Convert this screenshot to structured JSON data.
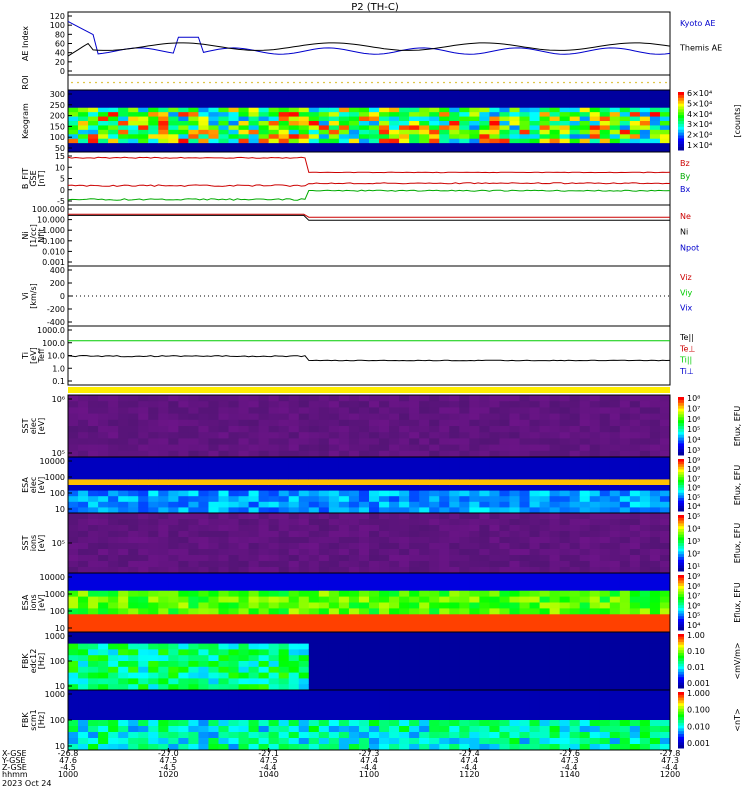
{
  "title": "P2 (TH-C)",
  "colors": {
    "frame": "#000000",
    "kyoto": "#0000cc",
    "themis": "#000000",
    "bz": "#cc0000",
    "by": "#00aa00",
    "bx": "#0000cc",
    "green": "#00cc00",
    "red": "#cc0000",
    "blue": "#0000cc",
    "flag": "#ffee00"
  },
  "panels": [
    {
      "id": "ae",
      "ylabel": [
        "AE Index"
      ],
      "ticks": [
        "120",
        "100",
        "80",
        "60",
        "40",
        "20",
        "0"
      ],
      "legend": [
        {
          "t": "Kyoto AE",
          "c": "#0000cc"
        },
        {
          "t": "Themis AE",
          "c": "#000000"
        }
      ]
    },
    {
      "id": "roi",
      "ylabel": [
        "ROI"
      ],
      "ticks": [],
      "legend": []
    },
    {
      "id": "keo",
      "ylabel": [
        "Keogram"
      ],
      "ticks": [
        "300",
        "250",
        "200",
        "150",
        "100",
        "50"
      ],
      "legend": [],
      "colorbar": {
        "labels": [
          "6×10⁴",
          "5×10⁴",
          "4×10⁴",
          "3×10⁴",
          "2×10⁴",
          "1×10⁴"
        ],
        "unit": "[counts]"
      }
    },
    {
      "id": "bfit",
      "ylabel": [
        "B_FIT",
        "GSE",
        "[nT]"
      ],
      "ticks": [
        "15",
        "10",
        "5",
        "0",
        "-5"
      ],
      "legend": [
        {
          "t": "Bz",
          "c": "#cc0000"
        },
        {
          "t": "By",
          "c": "#00aa00"
        },
        {
          "t": "Bx",
          "c": "#0000cc"
        }
      ]
    },
    {
      "id": "ni",
      "ylabel": [
        "Ni",
        "[1/cc]",
        "Nfit"
      ],
      "ticks": [
        "100.000",
        "10.000",
        "1.000",
        "0.100",
        "0.010",
        "0.001"
      ],
      "legend": [
        {
          "t": "Ne",
          "c": "#cc0000"
        },
        {
          "t": "Ni",
          "c": "#000000"
        },
        {
          "t": "Npot",
          "c": "#0000cc"
        }
      ]
    },
    {
      "id": "vi",
      "ylabel": [
        "Vi",
        "[km/s]"
      ],
      "ticks": [
        "400",
        "200",
        "0",
        "-200",
        "-400"
      ],
      "legend": [
        {
          "t": "Viz",
          "c": "#cc0000"
        },
        {
          "t": "Viy",
          "c": "#00cc00"
        },
        {
          "t": "Vix",
          "c": "#0000cc"
        }
      ]
    },
    {
      "id": "ti",
      "ylabel": [
        "Ti",
        "[eV]",
        "Teff"
      ],
      "ticks": [
        "1000.0",
        "100.0",
        "10.0",
        "1.0",
        "0.1"
      ],
      "legend": [
        {
          "t": "Te||",
          "c": "#000000"
        },
        {
          "t": "Te⊥",
          "c": "#cc0000"
        },
        {
          "t": "Ti||",
          "c": "#00cc00"
        },
        {
          "t": "Ti⊥",
          "c": "#0000cc"
        }
      ]
    },
    {
      "id": "sste",
      "ylabel": [
        "SST",
        "elec",
        "[eV]"
      ],
      "ticks": [
        "10⁶",
        "10⁵"
      ],
      "legend": [],
      "colorbar": {
        "labels": [
          "10⁸",
          "10⁷",
          "10⁶",
          "10⁵",
          "10⁴",
          "10³"
        ],
        "unit": "Eflux, EFU"
      }
    },
    {
      "id": "esae",
      "ylabel": [
        "ESA",
        "elec",
        "[eV]"
      ],
      "ticks": [
        "10000",
        "1000",
        "100",
        "10"
      ],
      "legend": [],
      "colorbar": {
        "labels": [
          "10⁹",
          "10⁸",
          "10⁷",
          "10⁶",
          "10⁵",
          "10⁴"
        ],
        "unit": "Eflux, EFU"
      }
    },
    {
      "id": "ssti",
      "ylabel": [
        "SST",
        "ions",
        "[eV]"
      ],
      "ticks": [
        "10⁵"
      ],
      "legend": [],
      "colorbar": {
        "labels": [
          "10⁵",
          "10⁴",
          "10³",
          "10²",
          "10¹"
        ],
        "unit": "Eflux, EFU"
      }
    },
    {
      "id": "esai",
      "ylabel": [
        "ESA",
        "ions",
        "[eV]"
      ],
      "ticks": [
        "10000",
        "1000",
        "100",
        "10"
      ],
      "legend": [],
      "colorbar": {
        "labels": [
          "10⁹",
          "10⁸",
          "10⁷",
          "10⁶",
          "10⁵",
          "10⁴"
        ],
        "unit": "Eflux, EFU"
      }
    },
    {
      "id": "fbke",
      "ylabel": [
        "FBK",
        "edc12",
        "[Hz]"
      ],
      "ticks": [
        "1000",
        "100",
        "10"
      ],
      "legend": [],
      "colorbar": {
        "labels": [
          "1.00",
          "0.10",
          "0.01",
          "0.001"
        ],
        "unit": "<mV/m>"
      }
    },
    {
      "id": "fbkb",
      "ylabel": [
        "FBK",
        "scm1",
        "[Hz]"
      ],
      "ticks": [
        "1000",
        "100",
        "10"
      ],
      "legend": [],
      "colorbar": {
        "labels": [
          "1.000",
          "0.100",
          "0.010",
          "0.001"
        ],
        "unit": "<nT>"
      }
    }
  ],
  "xaxis": {
    "row_labels": [
      "X-GSE",
      "Y-GSE",
      "Z-GSE",
      "hhmm",
      "2023 Oct 24"
    ],
    "columns": [
      {
        "x": "-26.8",
        "y": "47.6",
        "z": "-4.5",
        "t": "1000"
      },
      {
        "x": "-27.0",
        "y": "47.5",
        "z": "-4.5",
        "t": "1020"
      },
      {
        "x": "-27.1",
        "y": "47.5",
        "z": "-4.4",
        "t": "1040"
      },
      {
        "x": "-27.3",
        "y": "47.4",
        "z": "-4.4",
        "t": "1100"
      },
      {
        "x": "-27.4",
        "y": "47.4",
        "z": "-4.4",
        "t": "1120"
      },
      {
        "x": "-27.6",
        "y": "47.3",
        "z": "-4.4",
        "t": "1140"
      },
      {
        "x": "-27.8",
        "y": "47.3",
        "z": "-4.4",
        "t": "1200"
      }
    ]
  },
  "chart_data": {
    "type": "line",
    "title": "P2 (TH-C)",
    "x": [
      "1000",
      "1020",
      "1040",
      "1100",
      "1120",
      "1140",
      "1200"
    ],
    "xlabel": "hhmm",
    "series": [
      {
        "name": "Kyoto AE",
        "values": [
          120,
          40,
          40,
          40,
          45,
          35,
          45
        ]
      },
      {
        "name": "Themis AE",
        "values": [
          55,
          40,
          45,
          40,
          50,
          40,
          45
        ]
      },
      {
        "name": "Bz",
        "values": [
          12,
          12,
          12,
          4,
          4,
          4,
          4
        ]
      },
      {
        "name": "By",
        "values": [
          -1,
          -1,
          -1,
          -1,
          -1,
          -1,
          -1
        ]
      },
      {
        "name": "Bx",
        "values": [
          -6,
          -6,
          -6,
          -2,
          -2,
          -2,
          -2
        ]
      },
      {
        "name": "Ne",
        "values": [
          20,
          20,
          20,
          6,
          6,
          6,
          6
        ]
      },
      {
        "name": "Ni",
        "values": [
          20,
          20,
          20,
          5,
          5,
          5,
          5
        ]
      },
      {
        "name": "Ti||",
        "values": [
          800,
          800,
          800,
          800,
          800,
          800,
          800
        ]
      },
      {
        "name": "Te||",
        "values": [
          30,
          30,
          30,
          12,
          12,
          12,
          12
        ]
      }
    ]
  }
}
